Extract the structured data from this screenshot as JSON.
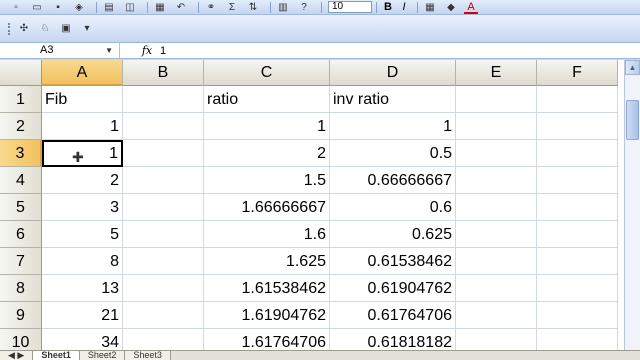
{
  "toolbar1": {
    "icons": [
      "new-icon",
      "open-icon",
      "save-icon",
      "permission-icon",
      "print-icon",
      "print-preview-icon",
      "paste-icon",
      "undo-icon",
      "hyperlink-icon",
      "autosum-icon",
      "sort-icon",
      "chart-icon",
      "help-icon"
    ],
    "font_size": "10",
    "bold_label": "B",
    "italic_label": "I",
    "font_color_label": "A",
    "autosum_label": "Σ"
  },
  "formula_bar": {
    "name_box": "A3",
    "fx_label": "fx",
    "value": "1"
  },
  "columns": [
    "A",
    "B",
    "C",
    "D",
    "E",
    "F"
  ],
  "selected_column": "A",
  "selected_row": "3",
  "rows": [
    {
      "num": "1",
      "cells": [
        "Fib",
        "",
        "ratio",
        "inv ratio",
        "",
        ""
      ]
    },
    {
      "num": "2",
      "cells": [
        "1",
        "",
        "1",
        "1",
        "",
        ""
      ]
    },
    {
      "num": "3",
      "cells": [
        "1",
        "",
        "2",
        "0.5",
        "",
        ""
      ]
    },
    {
      "num": "4",
      "cells": [
        "2",
        "",
        "1.5",
        "0.66666667",
        "",
        ""
      ]
    },
    {
      "num": "5",
      "cells": [
        "3",
        "",
        "1.66666667",
        "0.6",
        "",
        ""
      ]
    },
    {
      "num": "6",
      "cells": [
        "5",
        "",
        "1.6",
        "0.625",
        "",
        ""
      ]
    },
    {
      "num": "7",
      "cells": [
        "8",
        "",
        "1.625",
        "0.61538462",
        "",
        ""
      ]
    },
    {
      "num": "8",
      "cells": [
        "13",
        "",
        "1.61538462",
        "0.61904762",
        "",
        ""
      ]
    },
    {
      "num": "9",
      "cells": [
        "21",
        "",
        "1.61904762",
        "0.61764706",
        "",
        ""
      ]
    },
    {
      "num": "10",
      "cells": [
        "34",
        "",
        "1.61764706",
        "0.61818182",
        "",
        ""
      ]
    }
  ],
  "sheet_tabs": [
    "Sheet1",
    "Sheet2",
    "Sheet3"
  ],
  "active_sheet": "Sheet1",
  "colors": {
    "header_selected": "#f1c15f",
    "gridline": "#d0d7e5",
    "toolbar": "#c6d7f0"
  }
}
